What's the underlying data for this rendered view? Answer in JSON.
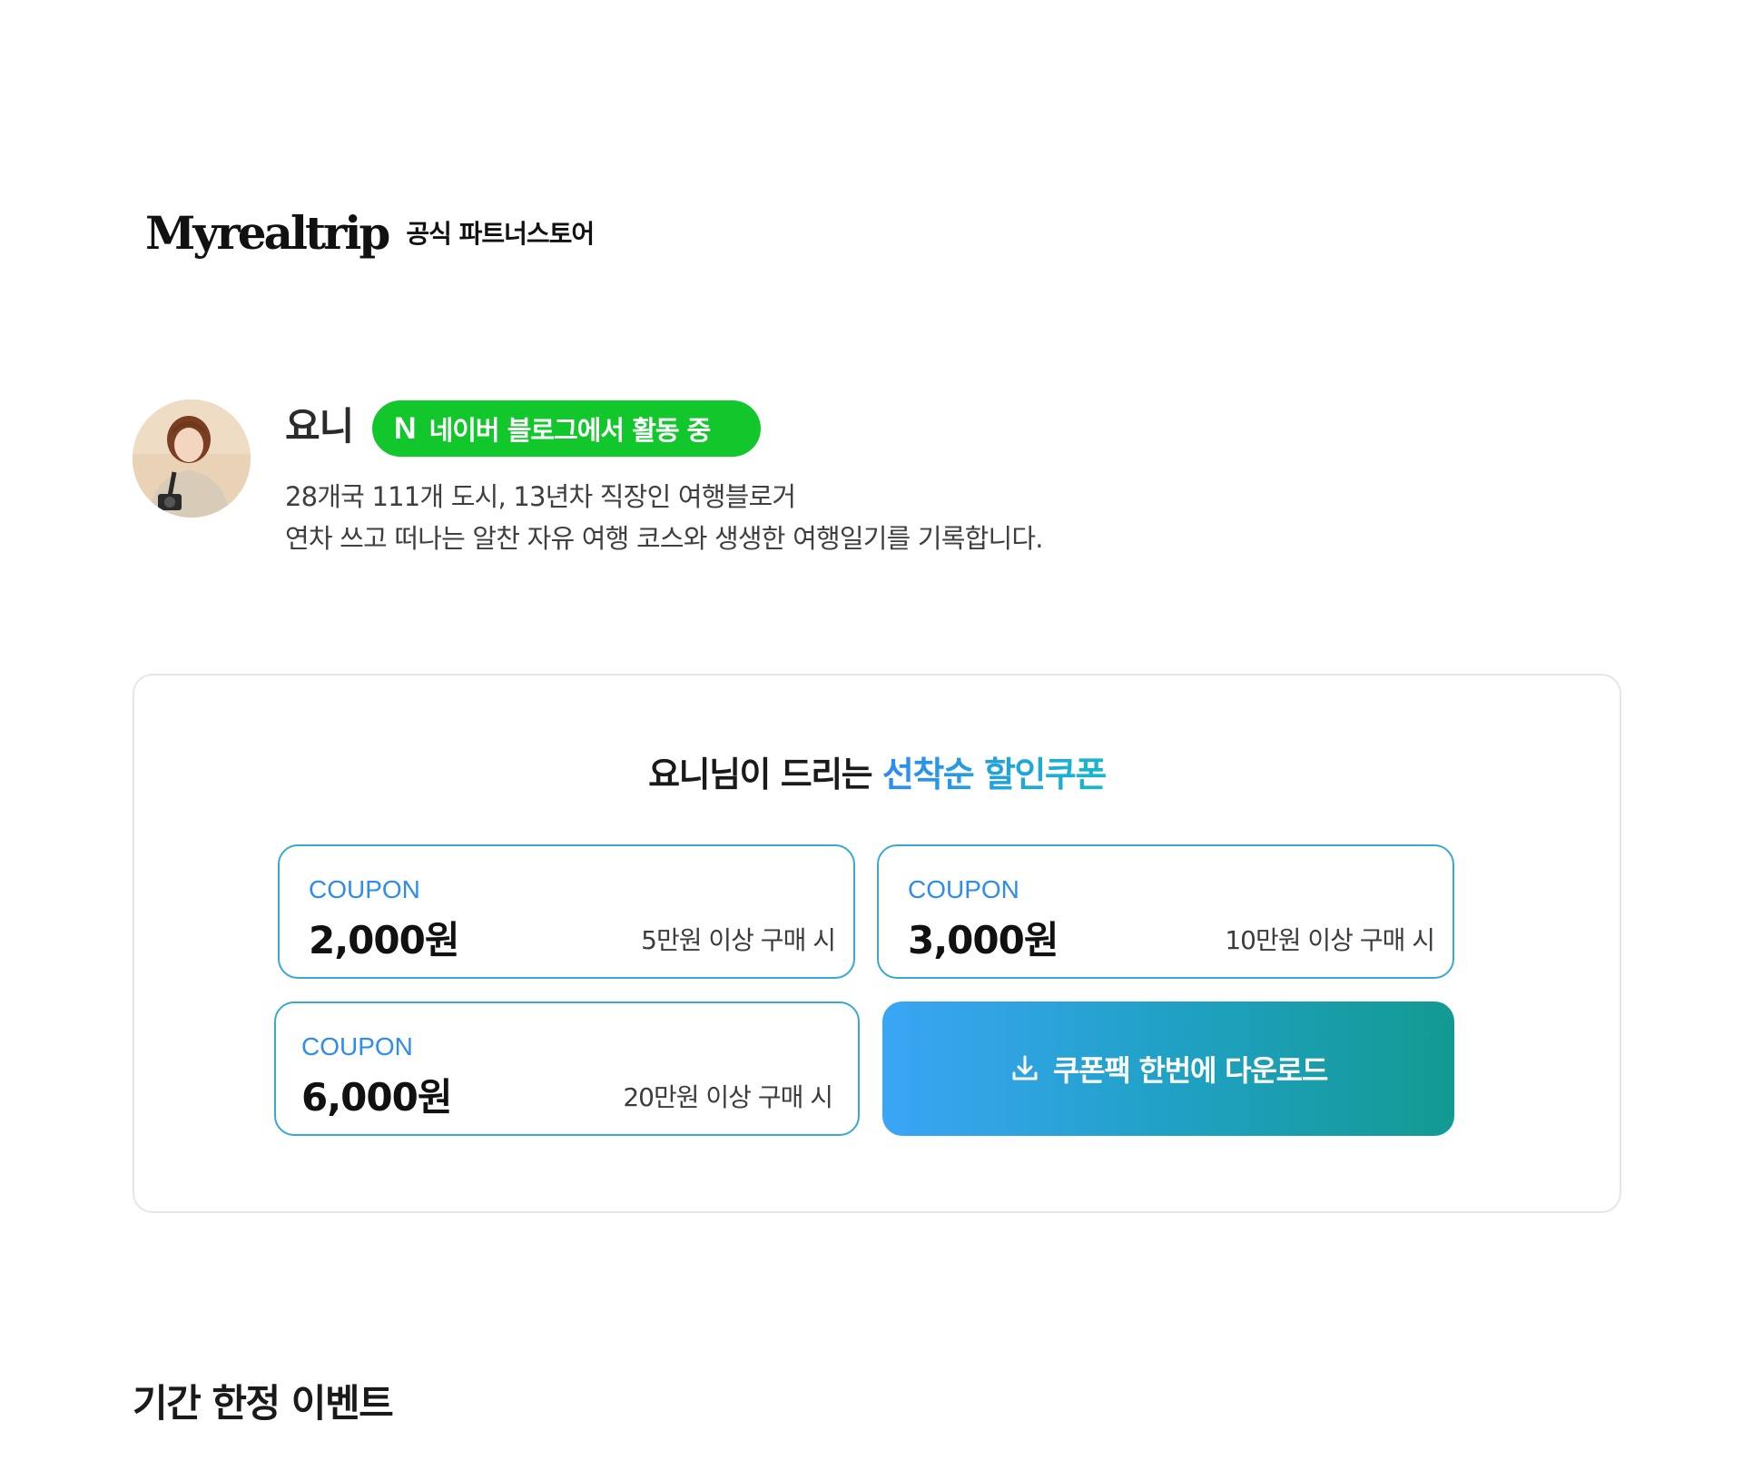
{
  "header": {
    "logo_text": "Myrealtrip",
    "store_label": "공식 파트너스토어"
  },
  "profile": {
    "name": "요니",
    "badge": {
      "logo": "N",
      "text": "네이버 블로그에서 활동 중",
      "color": "#12c72b"
    },
    "description_lines": [
      "28개국 111개 도시, 13년차 직장인 여행블로거",
      "연차 쓰고 떠나는 알찬 자유 여행 코스와 생생한 여행일기를 기록합니다."
    ]
  },
  "coupon_section": {
    "title_prefix": "요니님이 드리는 ",
    "title_accent": "선착순 할인쿠폰",
    "coupons": [
      {
        "label": "COUPON",
        "amount": "2,000원",
        "condition": "5만원 이상 구매 시"
      },
      {
        "label": "COUPON",
        "amount": "3,000원",
        "condition": "10만원 이상 구매 시"
      },
      {
        "label": "COUPON",
        "amount": "6,000원",
        "condition": "20만원 이상 구매 시"
      }
    ],
    "download_button": {
      "icon": "download-icon",
      "label": "쿠폰팩 한번에 다운로드"
    }
  },
  "events": {
    "title": "기간 한정 이벤트"
  },
  "colors": {
    "accent_blue": "#2e8cf0",
    "accent_teal": "#129a92",
    "coupon_border": "#3aa8d0",
    "naver_green": "#12c72b"
  }
}
